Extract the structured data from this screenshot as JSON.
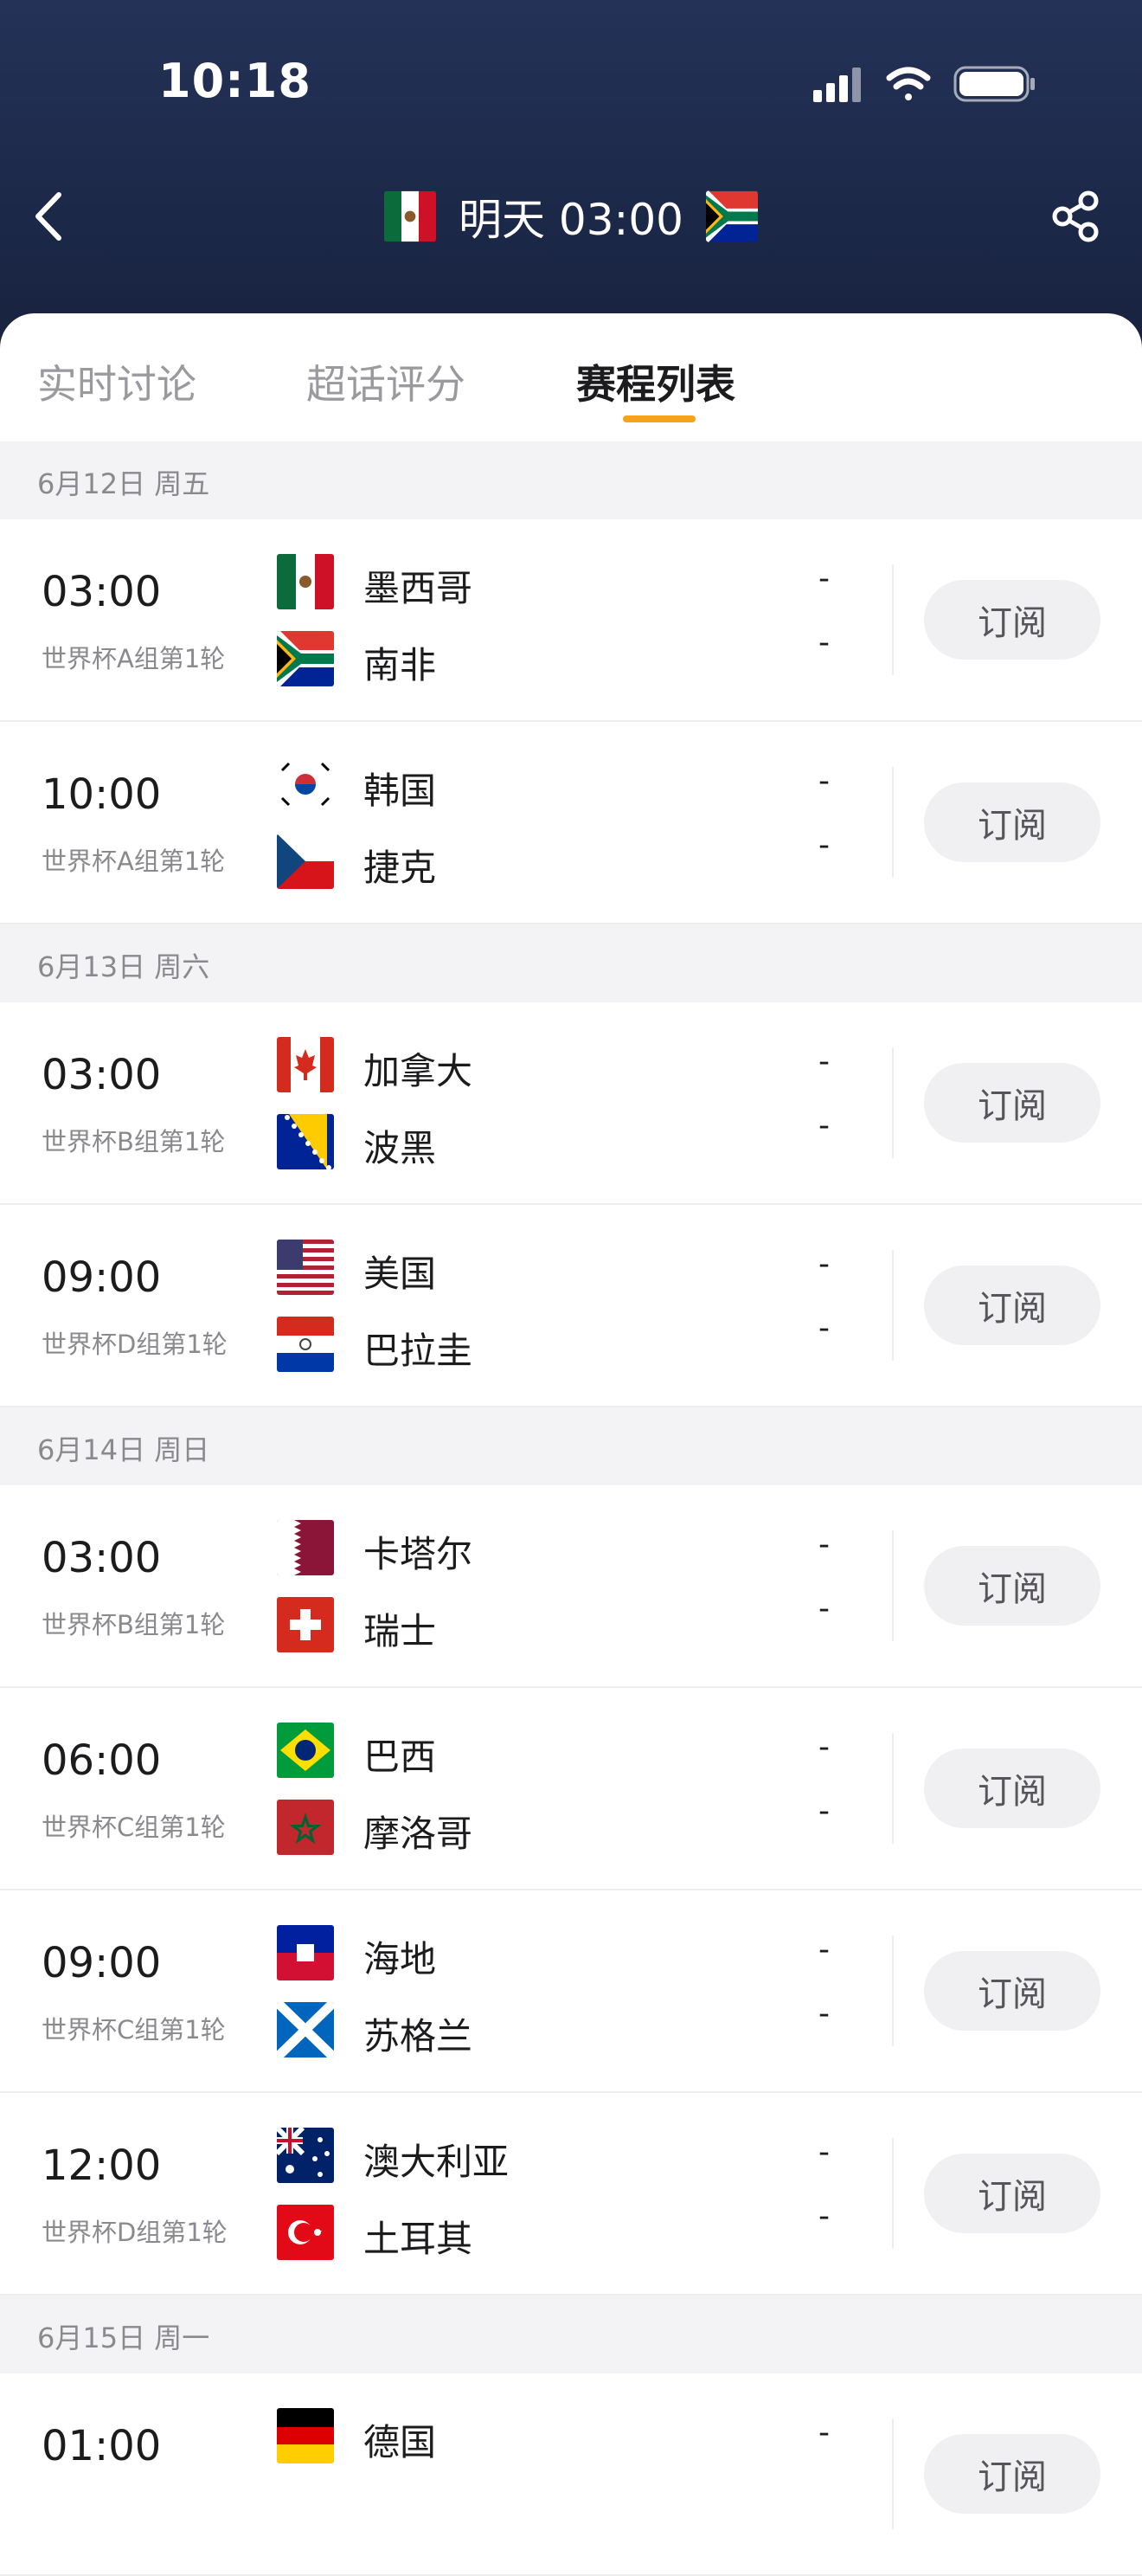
{
  "status": {
    "time": "10:18"
  },
  "header": {
    "title": "明天 03:00",
    "home_flag": "mexico-flag",
    "away_flag": "south-africa-flag"
  },
  "tabs": [
    {
      "label": "实时讨论",
      "active": false
    },
    {
      "label": "超话评分",
      "active": false
    },
    {
      "label": "赛程列表",
      "active": true
    }
  ],
  "accent_color": "#f7a21b",
  "days": [
    {
      "date": "6月12日 周五",
      "matches": [
        {
          "time": "03:00",
          "stage": "世界杯A组第1轮",
          "home": "墨西哥",
          "away": "南非",
          "home_flag": "mexico",
          "away_flag": "south-africa",
          "home_score": "-",
          "away_score": "-",
          "action": "订阅"
        },
        {
          "time": "10:00",
          "stage": "世界杯A组第1轮",
          "home": "韩国",
          "away": "捷克",
          "home_flag": "korea",
          "away_flag": "czech",
          "home_score": "-",
          "away_score": "-",
          "action": "订阅"
        }
      ]
    },
    {
      "date": "6月13日 周六",
      "matches": [
        {
          "time": "03:00",
          "stage": "世界杯B组第1轮",
          "home": "加拿大",
          "away": "波黑",
          "home_flag": "canada",
          "away_flag": "bosnia",
          "home_score": "-",
          "away_score": "-",
          "action": "订阅"
        },
        {
          "time": "09:00",
          "stage": "世界杯D组第1轮",
          "home": "美国",
          "away": "巴拉圭",
          "home_flag": "usa",
          "away_flag": "paraguay",
          "home_score": "-",
          "away_score": "-",
          "action": "订阅"
        }
      ]
    },
    {
      "date": "6月14日 周日",
      "matches": [
        {
          "time": "03:00",
          "stage": "世界杯B组第1轮",
          "home": "卡塔尔",
          "away": "瑞士",
          "home_flag": "qatar",
          "away_flag": "switzerland",
          "home_score": "-",
          "away_score": "-",
          "action": "订阅"
        },
        {
          "time": "06:00",
          "stage": "世界杯C组第1轮",
          "home": "巴西",
          "away": "摩洛哥",
          "home_flag": "brazil",
          "away_flag": "morocco",
          "home_score": "-",
          "away_score": "-",
          "action": "订阅"
        },
        {
          "time": "09:00",
          "stage": "世界杯C组第1轮",
          "home": "海地",
          "away": "苏格兰",
          "home_flag": "haiti",
          "away_flag": "scotland",
          "home_score": "-",
          "away_score": "-",
          "action": "订阅"
        },
        {
          "time": "12:00",
          "stage": "世界杯D组第1轮",
          "home": "澳大利亚",
          "away": "土耳其",
          "home_flag": "australia",
          "away_flag": "turkey",
          "home_score": "-",
          "away_score": "-",
          "action": "订阅"
        }
      ]
    },
    {
      "date": "6月15日 周一",
      "matches": [
        {
          "time": "01:00",
          "stage": "",
          "home": "德国",
          "away": "",
          "home_flag": "germany",
          "away_flag": "",
          "home_score": "-",
          "away_score": "",
          "action": "订阅"
        }
      ]
    }
  ]
}
